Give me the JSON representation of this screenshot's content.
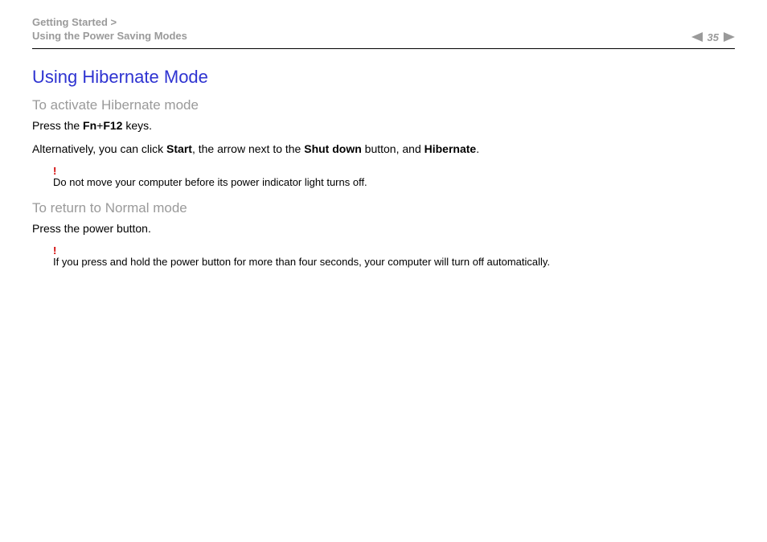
{
  "header": {
    "breadcrumb_line1": "Getting Started >",
    "breadcrumb_line2": "Using the Power Saving Modes",
    "page_number": "35"
  },
  "content": {
    "heading": "Using Hibernate Mode",
    "section1": {
      "subheading": "To activate Hibernate mode",
      "line1_pre": "Press the ",
      "line1_b1": "Fn",
      "line1_plus": "+",
      "line1_b2": "F12",
      "line1_post": " keys.",
      "line2_pre": "Alternatively, you can click ",
      "line2_b1": "Start",
      "line2_mid1": ", the arrow next to the ",
      "line2_b2": "Shut down",
      "line2_mid2": " button, and ",
      "line2_b3": "Hibernate",
      "line2_post": ".",
      "note_bang": "!",
      "note_text": "Do not move your computer before its power indicator light turns off."
    },
    "section2": {
      "subheading": "To return to Normal mode",
      "line1": "Press the power button.",
      "note_bang": "!",
      "note_text": "If you press and hold the power button for more than four seconds, your computer will turn off automatically."
    }
  }
}
